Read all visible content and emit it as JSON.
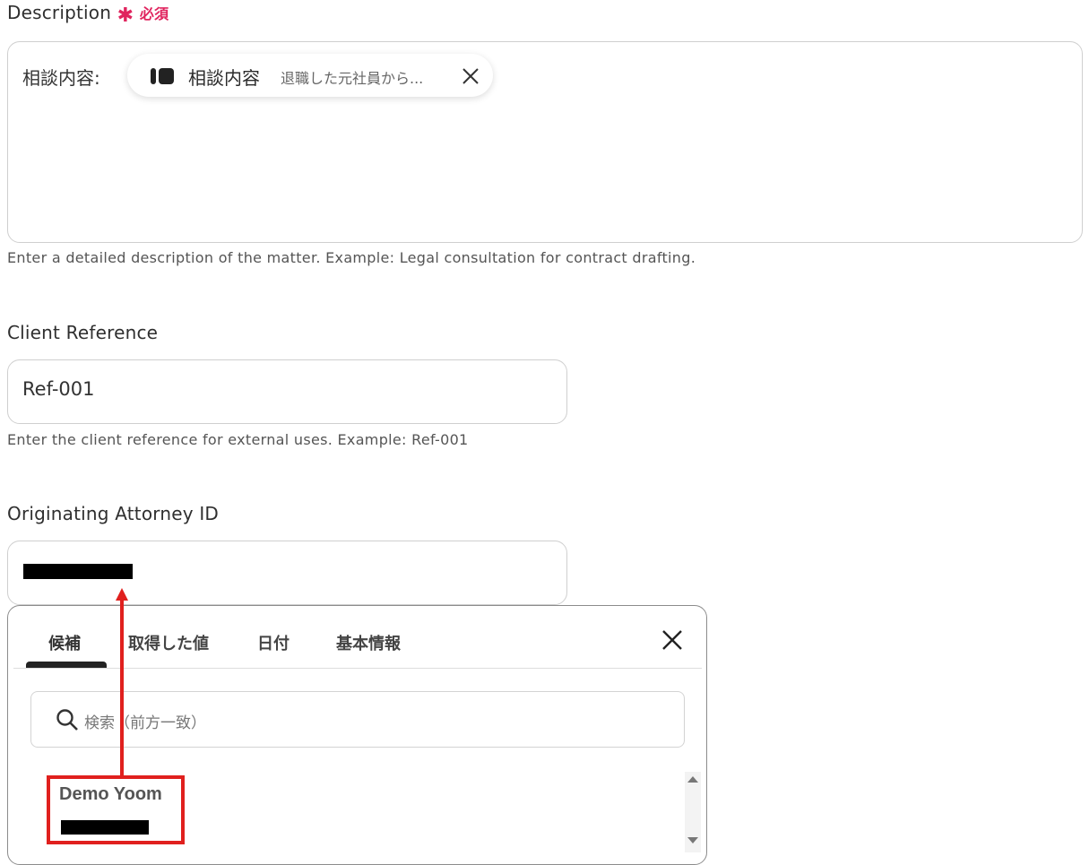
{
  "description": {
    "label": "Description",
    "required_label": "必須",
    "prefix": "相談内容:",
    "chip": {
      "icon": "yoom-logo-icon",
      "title": "相談内容",
      "value": "退職した元社員から..."
    },
    "help": "Enter a detailed description of the matter. Example: Legal consultation for contract drafting."
  },
  "client_reference": {
    "label": "Client Reference",
    "value": "Ref-001",
    "help": "Enter the client reference for external uses. Example: Ref-001"
  },
  "originating_attorney": {
    "label": "Originating Attorney ID"
  },
  "popup": {
    "tabs": [
      "候補",
      "取得した値",
      "日付",
      "基本情報"
    ],
    "active_tab": "候補",
    "search_placeholder": "検索（前方一致）",
    "suggestions": [
      {
        "name": "Demo Yoom"
      }
    ]
  },
  "colors": {
    "required": "#e0245e",
    "annotation": "#e0201e"
  }
}
